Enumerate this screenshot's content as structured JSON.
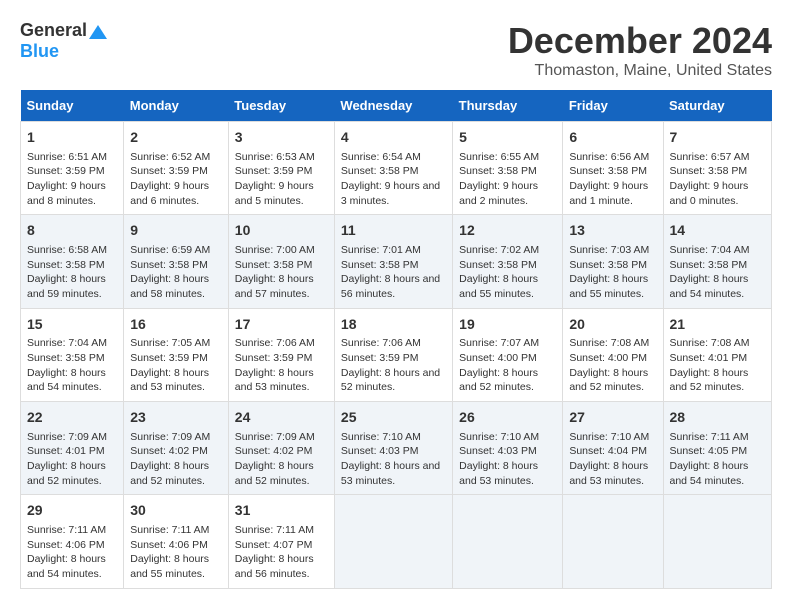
{
  "header": {
    "logo_general": "General",
    "logo_blue": "Blue",
    "month": "December 2024",
    "location": "Thomaston, Maine, United States"
  },
  "days_of_week": [
    "Sunday",
    "Monday",
    "Tuesday",
    "Wednesday",
    "Thursday",
    "Friday",
    "Saturday"
  ],
  "weeks": [
    [
      {
        "day": "1",
        "sunrise": "Sunrise: 6:51 AM",
        "sunset": "Sunset: 3:59 PM",
        "daylight": "Daylight: 9 hours and 8 minutes."
      },
      {
        "day": "2",
        "sunrise": "Sunrise: 6:52 AM",
        "sunset": "Sunset: 3:59 PM",
        "daylight": "Daylight: 9 hours and 6 minutes."
      },
      {
        "day": "3",
        "sunrise": "Sunrise: 6:53 AM",
        "sunset": "Sunset: 3:59 PM",
        "daylight": "Daylight: 9 hours and 5 minutes."
      },
      {
        "day": "4",
        "sunrise": "Sunrise: 6:54 AM",
        "sunset": "Sunset: 3:58 PM",
        "daylight": "Daylight: 9 hours and 3 minutes."
      },
      {
        "day": "5",
        "sunrise": "Sunrise: 6:55 AM",
        "sunset": "Sunset: 3:58 PM",
        "daylight": "Daylight: 9 hours and 2 minutes."
      },
      {
        "day": "6",
        "sunrise": "Sunrise: 6:56 AM",
        "sunset": "Sunset: 3:58 PM",
        "daylight": "Daylight: 9 hours and 1 minute."
      },
      {
        "day": "7",
        "sunrise": "Sunrise: 6:57 AM",
        "sunset": "Sunset: 3:58 PM",
        "daylight": "Daylight: 9 hours and 0 minutes."
      }
    ],
    [
      {
        "day": "8",
        "sunrise": "Sunrise: 6:58 AM",
        "sunset": "Sunset: 3:58 PM",
        "daylight": "Daylight: 8 hours and 59 minutes."
      },
      {
        "day": "9",
        "sunrise": "Sunrise: 6:59 AM",
        "sunset": "Sunset: 3:58 PM",
        "daylight": "Daylight: 8 hours and 58 minutes."
      },
      {
        "day": "10",
        "sunrise": "Sunrise: 7:00 AM",
        "sunset": "Sunset: 3:58 PM",
        "daylight": "Daylight: 8 hours and 57 minutes."
      },
      {
        "day": "11",
        "sunrise": "Sunrise: 7:01 AM",
        "sunset": "Sunset: 3:58 PM",
        "daylight": "Daylight: 8 hours and 56 minutes."
      },
      {
        "day": "12",
        "sunrise": "Sunrise: 7:02 AM",
        "sunset": "Sunset: 3:58 PM",
        "daylight": "Daylight: 8 hours and 55 minutes."
      },
      {
        "day": "13",
        "sunrise": "Sunrise: 7:03 AM",
        "sunset": "Sunset: 3:58 PM",
        "daylight": "Daylight: 8 hours and 55 minutes."
      },
      {
        "day": "14",
        "sunrise": "Sunrise: 7:04 AM",
        "sunset": "Sunset: 3:58 PM",
        "daylight": "Daylight: 8 hours and 54 minutes."
      }
    ],
    [
      {
        "day": "15",
        "sunrise": "Sunrise: 7:04 AM",
        "sunset": "Sunset: 3:58 PM",
        "daylight": "Daylight: 8 hours and 54 minutes."
      },
      {
        "day": "16",
        "sunrise": "Sunrise: 7:05 AM",
        "sunset": "Sunset: 3:59 PM",
        "daylight": "Daylight: 8 hours and 53 minutes."
      },
      {
        "day": "17",
        "sunrise": "Sunrise: 7:06 AM",
        "sunset": "Sunset: 3:59 PM",
        "daylight": "Daylight: 8 hours and 53 minutes."
      },
      {
        "day": "18",
        "sunrise": "Sunrise: 7:06 AM",
        "sunset": "Sunset: 3:59 PM",
        "daylight": "Daylight: 8 hours and 52 minutes."
      },
      {
        "day": "19",
        "sunrise": "Sunrise: 7:07 AM",
        "sunset": "Sunset: 4:00 PM",
        "daylight": "Daylight: 8 hours and 52 minutes."
      },
      {
        "day": "20",
        "sunrise": "Sunrise: 7:08 AM",
        "sunset": "Sunset: 4:00 PM",
        "daylight": "Daylight: 8 hours and 52 minutes."
      },
      {
        "day": "21",
        "sunrise": "Sunrise: 7:08 AM",
        "sunset": "Sunset: 4:01 PM",
        "daylight": "Daylight: 8 hours and 52 minutes."
      }
    ],
    [
      {
        "day": "22",
        "sunrise": "Sunrise: 7:09 AM",
        "sunset": "Sunset: 4:01 PM",
        "daylight": "Daylight: 8 hours and 52 minutes."
      },
      {
        "day": "23",
        "sunrise": "Sunrise: 7:09 AM",
        "sunset": "Sunset: 4:02 PM",
        "daylight": "Daylight: 8 hours and 52 minutes."
      },
      {
        "day": "24",
        "sunrise": "Sunrise: 7:09 AM",
        "sunset": "Sunset: 4:02 PM",
        "daylight": "Daylight: 8 hours and 52 minutes."
      },
      {
        "day": "25",
        "sunrise": "Sunrise: 7:10 AM",
        "sunset": "Sunset: 4:03 PM",
        "daylight": "Daylight: 8 hours and 53 minutes."
      },
      {
        "day": "26",
        "sunrise": "Sunrise: 7:10 AM",
        "sunset": "Sunset: 4:03 PM",
        "daylight": "Daylight: 8 hours and 53 minutes."
      },
      {
        "day": "27",
        "sunrise": "Sunrise: 7:10 AM",
        "sunset": "Sunset: 4:04 PM",
        "daylight": "Daylight: 8 hours and 53 minutes."
      },
      {
        "day": "28",
        "sunrise": "Sunrise: 7:11 AM",
        "sunset": "Sunset: 4:05 PM",
        "daylight": "Daylight: 8 hours and 54 minutes."
      }
    ],
    [
      {
        "day": "29",
        "sunrise": "Sunrise: 7:11 AM",
        "sunset": "Sunset: 4:06 PM",
        "daylight": "Daylight: 8 hours and 54 minutes."
      },
      {
        "day": "30",
        "sunrise": "Sunrise: 7:11 AM",
        "sunset": "Sunset: 4:06 PM",
        "daylight": "Daylight: 8 hours and 55 minutes."
      },
      {
        "day": "31",
        "sunrise": "Sunrise: 7:11 AM",
        "sunset": "Sunset: 4:07 PM",
        "daylight": "Daylight: 8 hours and 56 minutes."
      },
      null,
      null,
      null,
      null
    ]
  ]
}
